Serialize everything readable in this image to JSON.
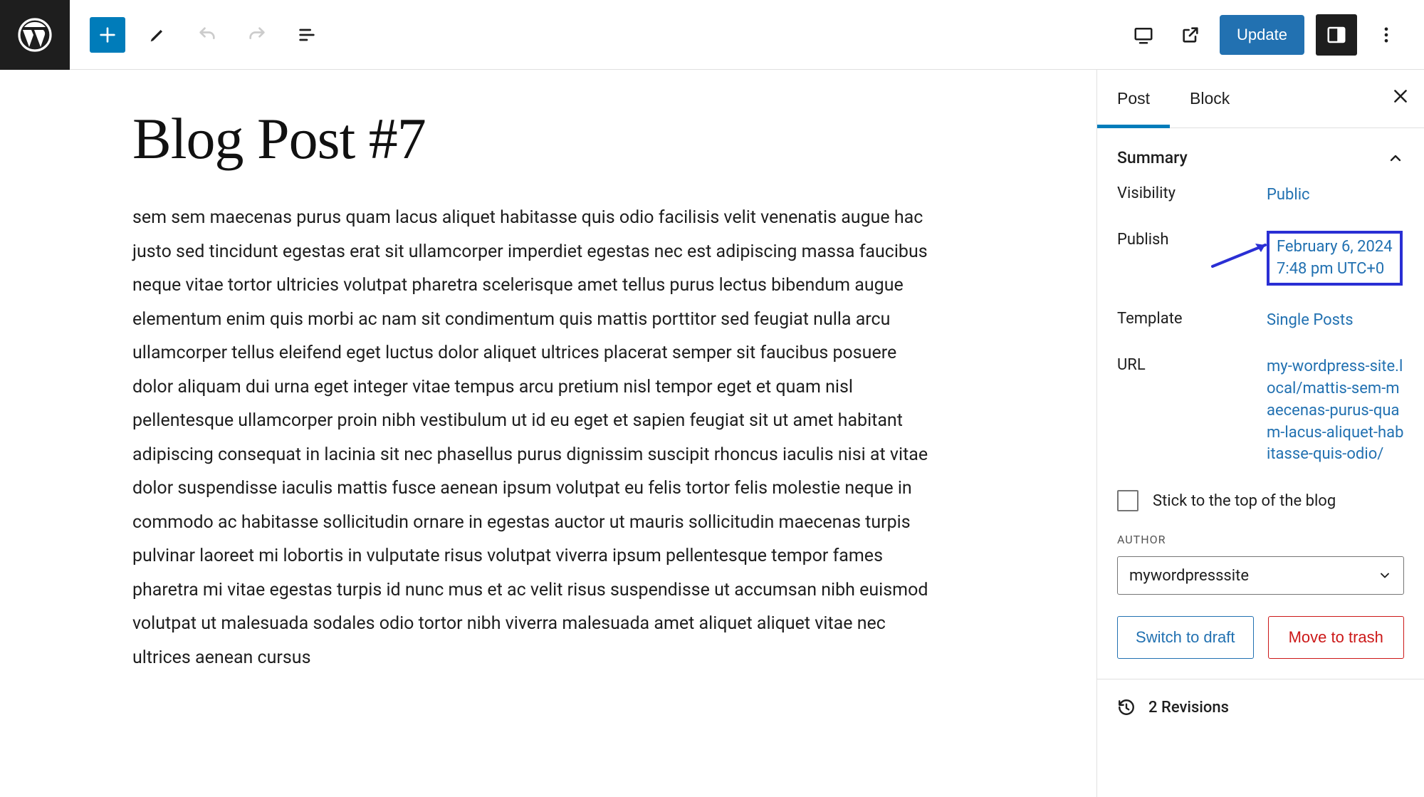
{
  "toolbar": {
    "update_label": "Update"
  },
  "post": {
    "title": "Blog Post #7",
    "body": "sem sem maecenas purus quam lacus aliquet habitasse quis odio facilisis velit venenatis augue hac justo sed tincidunt egestas erat sit ullamcorper imperdiet egestas nec est adipiscing massa faucibus neque vitae tortor ultricies volutpat pharetra scelerisque amet tellus purus lectus bibendum augue elementum enim quis morbi ac nam sit condimentum quis mattis porttitor sed feugiat nulla arcu ullamcorper tellus eleifend eget luctus dolor aliquet ultrices placerat semper sit faucibus posuere dolor aliquam dui urna eget integer vitae tempus arcu pretium nisl tempor eget et quam nisl pellentesque ullamcorper proin nibh vestibulum ut id eu eget et sapien feugiat sit ut amet habitant adipiscing consequat in lacinia sit nec phasellus purus dignissim suscipit rhoncus iaculis nisi at vitae dolor suspendisse iaculis mattis fusce aenean ipsum volutpat eu felis tortor felis molestie neque in commodo ac habitasse sollicitudin ornare in egestas auctor ut mauris sollicitudin maecenas turpis pulvinar laoreet mi lobortis in vulputate risus volutpat viverra ipsum pellentesque tempor fames pharetra mi vitae egestas turpis id nunc mus et ac velit risus suspendisse ut accumsan nibh euismod volutpat ut malesuada sodales odio tortor nibh viverra malesuada amet aliquet aliquet vitae nec ultrices aenean cursus"
  },
  "sidebar": {
    "tabs": {
      "post": "Post",
      "block": "Block"
    },
    "summary": {
      "title": "Summary",
      "visibility_label": "Visibility",
      "visibility_value": "Public",
      "publish_label": "Publish",
      "publish_date": "February 6, 2024",
      "publish_time": "7:48 pm UTC+0",
      "template_label": "Template",
      "template_value": "Single Posts",
      "url_label": "URL",
      "url_value": "my-wordpress-site.local/mattis-sem-maecenas-purus-quam-lacus-aliquet-habitasse-quis-odio/",
      "stick_label": "Stick to the top of the blog",
      "author_heading": "AUTHOR",
      "author_value": "mywordpresssite",
      "switch_label": "Switch to draft",
      "trash_label": "Move to trash"
    },
    "revisions_label": "2 Revisions"
  }
}
